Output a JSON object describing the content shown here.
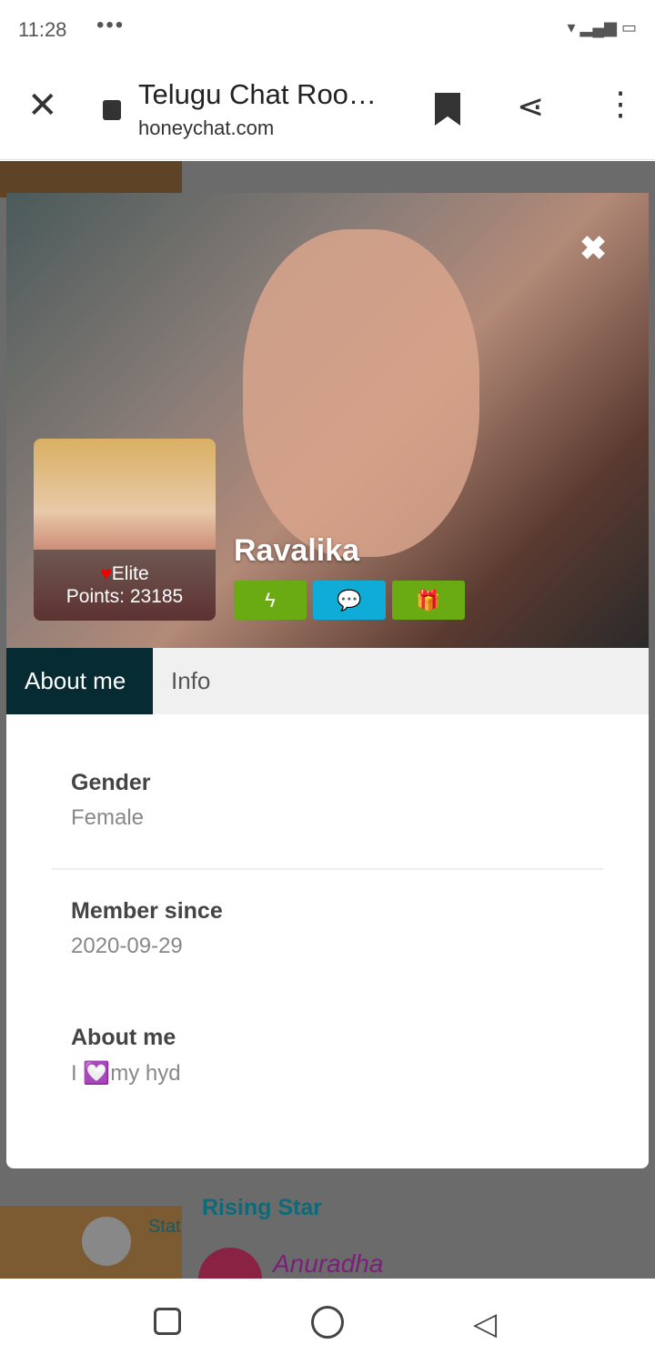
{
  "status_bar": {
    "time": "11:28",
    "dots": "•••",
    "icons": "wifi signal battery"
  },
  "browser": {
    "title": "Telugu Chat Roo…",
    "host": "honeychat.com",
    "close_icon": "✕",
    "share_icon": "share-icon",
    "menu_icon": "⋮"
  },
  "background_page": {
    "section_title": "Rising Star",
    "user": "Anuradha",
    "status_label": "Stat",
    "emoji": "😎"
  },
  "profile": {
    "close": "✖",
    "rank": "Elite",
    "heart": "♥",
    "points": "Points: 23185",
    "name": "Ravalika",
    "buttons": [
      {
        "icon": "lightning-icon",
        "glyph": "ϟ",
        "color": "#6aaa12"
      },
      {
        "icon": "chat-icon",
        "glyph": "💬",
        "color": "#0eacd6"
      },
      {
        "icon": "gift-icon",
        "glyph": "🎁",
        "color": "#6aaa12"
      }
    ],
    "tabs": [
      "About me",
      "Info"
    ],
    "fields": [
      {
        "label": "Gender",
        "value": "Female"
      },
      {
        "label": "Member since",
        "value": "2020-09-29"
      },
      {
        "label": "About me",
        "value": "I 💟my hyd"
      }
    ]
  }
}
